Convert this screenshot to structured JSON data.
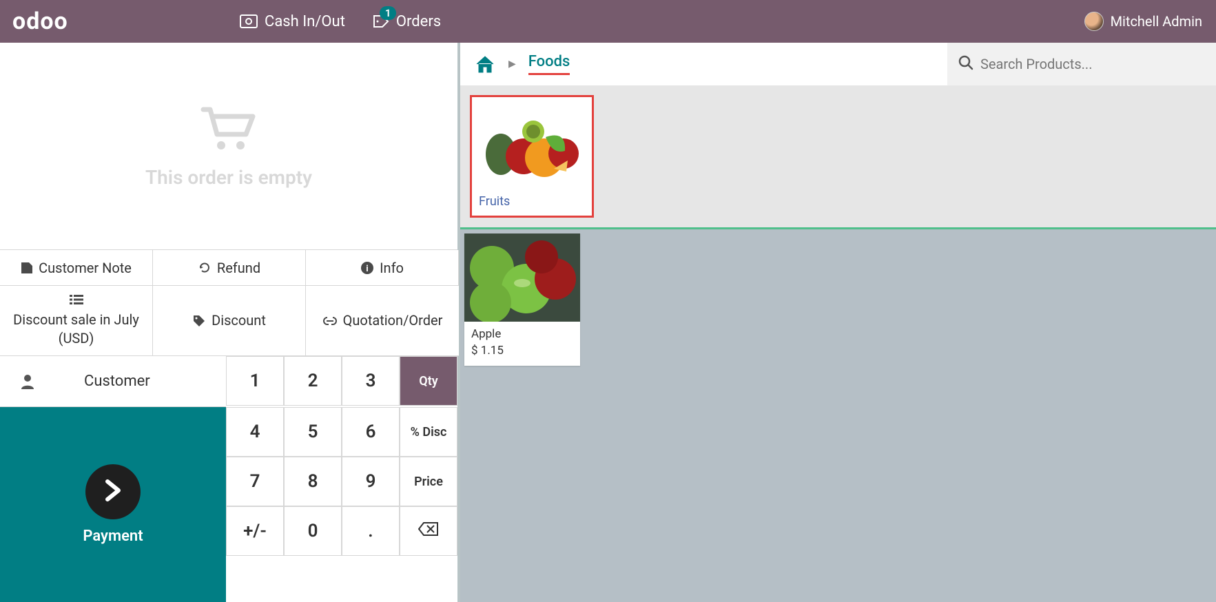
{
  "header": {
    "logo": "odoo",
    "cash_label": "Cash In/Out",
    "orders_label": "Orders",
    "orders_badge": "1",
    "username": "Mitchell Admin"
  },
  "order": {
    "empty_text": "This order is empty"
  },
  "actions": {
    "note": "Customer Note",
    "refund": "Refund",
    "info": "Info",
    "discount_sale": "Discount sale in July (USD)",
    "discount": "Discount",
    "quotation": "Quotation/Order"
  },
  "customer": {
    "label": "Customer"
  },
  "payment": {
    "label": "Payment"
  },
  "numpad": {
    "k1": "1",
    "k2": "2",
    "k3": "3",
    "k4": "4",
    "k5": "5",
    "k6": "6",
    "k7": "7",
    "k8": "8",
    "k9": "9",
    "pm": "+/-",
    "k0": "0",
    "dot": ".",
    "qty": "Qty",
    "disc": "% Disc",
    "price": "Price"
  },
  "breadcrumb": {
    "current": "Foods"
  },
  "search": {
    "placeholder": "Search Products..."
  },
  "categories": [
    {
      "label": "Fruits"
    }
  ],
  "products": [
    {
      "name": "Apple",
      "price": "$ 1.15"
    }
  ]
}
